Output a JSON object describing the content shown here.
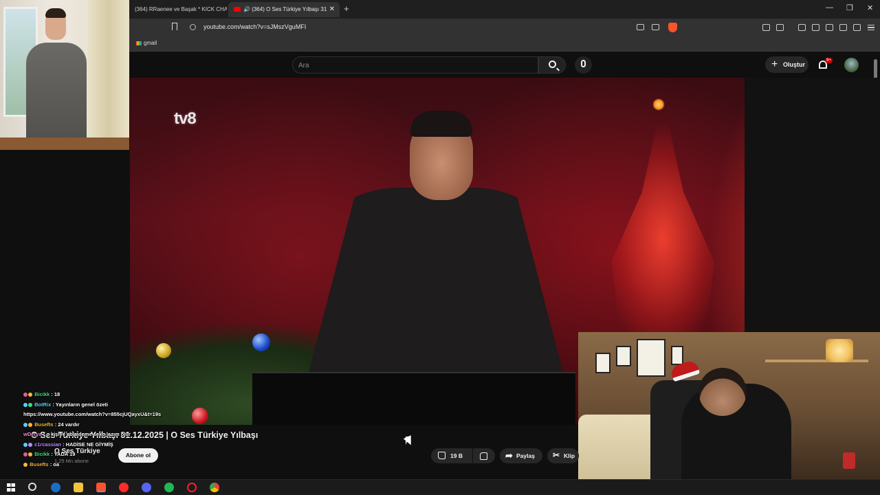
{
  "browser": {
    "tabs": [
      {
        "label": "(364) RRaenee ve Başak * KICK CHAT",
        "active": false
      },
      {
        "label": "(364) O Ses Türkiye Yılbaşı 31",
        "active": true
      }
    ],
    "url": "youtube.com/watch?v=sJMszVguMFI",
    "bookmarks": [
      {
        "label": "gmail"
      }
    ]
  },
  "youtube": {
    "search_placeholder": "Ara",
    "create_label": "Oluştur",
    "notification_count": "9+",
    "video": {
      "channel_logo_text": "tv8",
      "title": "O Ses Türkiye Yılbaşı 31.12.2025 | O Ses Türkiye Yılbaşı",
      "channel": "O Ses Türkiye",
      "subscribers": "1,25 Mn abone",
      "subscribe_label": "Abone ol",
      "likes": "19 B",
      "share_label": "Paylaş",
      "clip_label": "Klip"
    }
  },
  "chat": [
    {
      "user": "Bicikk",
      "user_color": "#3ddc84",
      "text": ": 18"
    },
    {
      "user": "BotRix",
      "user_color": "#5ad0ff",
      "text": ": Yayınların genel özeti"
    },
    {
      "user": "",
      "user_color": "#ffffff",
      "text": "https://www.youtube.com/watch?v=855cjUQayxU&t=19s"
    },
    {
      "user": "Busefts",
      "user_color": "#f5b642",
      "text": ": 24 vardır"
    },
    {
      "user": "wDerya",
      "user_color": "#ff8ad8",
      "text": ": o kişiye abla deme seko lazım olur"
    },
    {
      "user": "c1rcassian",
      "user_color": "#b98bff",
      "text": ": HADİSE NE GİYMİŞ"
    },
    {
      "user": "Bicikk",
      "user_color": "#3ddc84",
      "text": ": YADA 19"
    },
    {
      "user": "Busefts",
      "user_color": "#f5b642",
      "text": ": oa"
    }
  ],
  "colors": {
    "youtube_red": "#ff0000",
    "brave_orange": "#fb542b",
    "page_bg": "#0f0f0f"
  },
  "taskbar": {
    "icons": [
      "windows-icon",
      "search-icon",
      "steam-icon",
      "file-explorer-icon",
      "brave-icon",
      "youtube-music-icon",
      "discord-icon",
      "spotify-icon",
      "opera-icon",
      "chrome-icon"
    ]
  }
}
